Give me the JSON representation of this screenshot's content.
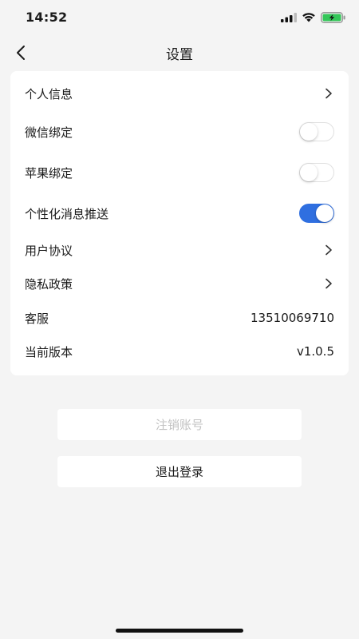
{
  "status_bar": {
    "time": "14:52",
    "icons": [
      "signal-icon",
      "wifi-icon",
      "battery-charging-icon"
    ]
  },
  "nav": {
    "title": "设置",
    "back_icon": "chevron-left-icon"
  },
  "settings": {
    "items": [
      {
        "label": "个人信息",
        "type": "link",
        "icon": "chevron-right-icon"
      },
      {
        "label": "微信绑定",
        "type": "toggle",
        "on": false
      },
      {
        "label": "苹果绑定",
        "type": "toggle",
        "on": false
      },
      {
        "label": "个性化消息推送",
        "type": "toggle",
        "on": true
      },
      {
        "label": "用户协议",
        "type": "link",
        "icon": "chevron-right-icon"
      },
      {
        "label": "隐私政策",
        "type": "link",
        "icon": "chevron-right-icon"
      },
      {
        "label": "客服",
        "type": "value",
        "value": "13510069710"
      },
      {
        "label": "当前版本",
        "type": "value",
        "value": "v1.0.5"
      }
    ]
  },
  "buttons": {
    "cancel_account": "注销账号",
    "logout": "退出登录"
  },
  "colors": {
    "toggle_on": "#2f6fe0",
    "background": "#f4f4f4",
    "disabled_text": "#c2c2c2"
  }
}
